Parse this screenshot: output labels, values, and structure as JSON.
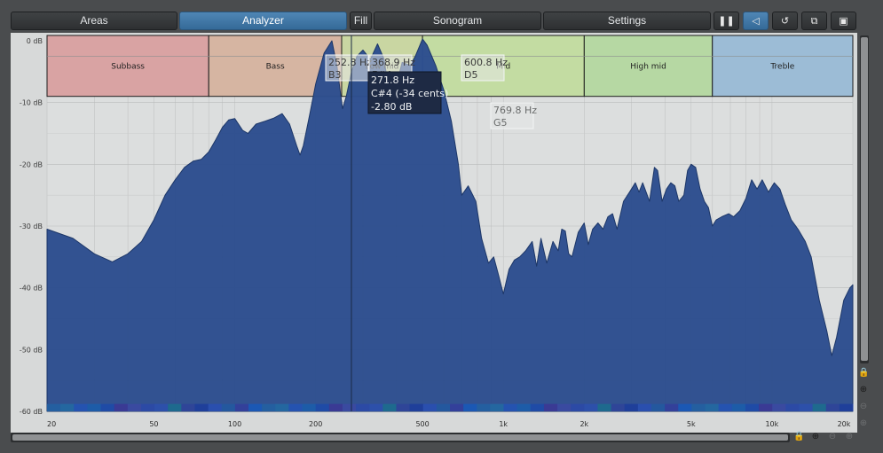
{
  "toolbar": {
    "tabs": [
      {
        "label": "Areas",
        "active": false
      },
      {
        "label": "Analyzer",
        "active": true
      },
      {
        "label": "Fill",
        "active": false
      },
      {
        "label": "Sonogram",
        "active": false
      },
      {
        "label": "Settings",
        "active": false
      }
    ],
    "icon_buttons": [
      {
        "icon": "pause-icon",
        "glyph": "❚❚",
        "active": false
      },
      {
        "icon": "speaker-select-icon",
        "glyph": "◁",
        "active": true
      },
      {
        "icon": "reset-icon",
        "glyph": "↺",
        "active": false
      },
      {
        "icon": "copy-icon",
        "glyph": "⧉",
        "active": false
      },
      {
        "icon": "paste-icon",
        "glyph": "▣",
        "active": false
      }
    ]
  },
  "colors": {
    "spectrum_fill": "#2e4f8f",
    "spectrum_stroke": "#1d3768",
    "plot_bg": "#d7d9d9",
    "grid": "#c2c4c4",
    "accent": "#3f78aa"
  },
  "y_axis": {
    "labels": [
      "0 dB",
      "-10 dB",
      "-20 dB",
      "-30 dB",
      "-40 dB",
      "-50 dB",
      "-60 dB"
    ],
    "values": [
      0,
      -10,
      -20,
      -30,
      -40,
      -50,
      -60
    ],
    "range": [
      -60,
      0
    ]
  },
  "x_axis": {
    "labels": [
      "20",
      "50",
      "100",
      "200",
      "500",
      "1k",
      "2k",
      "5k",
      "10k",
      "20k"
    ],
    "values": [
      20,
      50,
      100,
      200,
      500,
      1000,
      2000,
      5000,
      10000,
      20000
    ],
    "scale": "log",
    "range": [
      20,
      20000
    ]
  },
  "bands": [
    {
      "label": "Subbass",
      "from": 20,
      "to": 80,
      "color": "#d9a3a3"
    },
    {
      "label": "Bass",
      "from": 80,
      "to": 250,
      "color": "#d6b5a2"
    },
    {
      "label": "Low mid",
      "from": 250,
      "to": 500,
      "color": "#c9d6a2"
    },
    {
      "label": "Mid",
      "from": 500,
      "to": 2000,
      "color": "#c3dca2"
    },
    {
      "label": "High mid",
      "from": 2000,
      "to": 6000,
      "color": "#b6d8a3"
    },
    {
      "label": "Treble",
      "from": 6000,
      "to": 20000,
      "color": "#9cbcd6"
    }
  ],
  "spectrum": {
    "points": [
      [
        20,
        -30.5
      ],
      [
        25,
        -32
      ],
      [
        30,
        -34.5
      ],
      [
        35,
        -35.8
      ],
      [
        40,
        -34.5
      ],
      [
        45,
        -32.5
      ],
      [
        50,
        -29
      ],
      [
        55,
        -25
      ],
      [
        60,
        -22.5
      ],
      [
        65,
        -20.5
      ],
      [
        70,
        -19.5
      ],
      [
        75,
        -19.2
      ],
      [
        80,
        -18
      ],
      [
        85,
        -16
      ],
      [
        90,
        -14
      ],
      [
        95,
        -12.8
      ],
      [
        100,
        -12.6
      ],
      [
        107,
        -14.5
      ],
      [
        112,
        -15
      ],
      [
        120,
        -13.5
      ],
      [
        130,
        -13
      ],
      [
        140,
        -12.5
      ],
      [
        150,
        -11.8
      ],
      [
        160,
        -13.5
      ],
      [
        170,
        -17
      ],
      [
        175,
        -18.5
      ],
      [
        180,
        -17
      ],
      [
        190,
        -12
      ],
      [
        200,
        -7
      ],
      [
        215,
        -2
      ],
      [
        230,
        0
      ],
      [
        240,
        -4
      ],
      [
        252,
        -11
      ],
      [
        260,
        -9
      ],
      [
        272,
        -5
      ],
      [
        285,
        -2.5
      ],
      [
        300,
        -1.5
      ],
      [
        320,
        -3
      ],
      [
        340,
        -0.5
      ],
      [
        360,
        -3
      ],
      [
        380,
        -10
      ],
      [
        390,
        -11.5
      ],
      [
        400,
        -7
      ],
      [
        420,
        -3.5
      ],
      [
        450,
        -4
      ],
      [
        470,
        -2.5
      ],
      [
        500,
        0.3
      ],
      [
        520,
        -0.7
      ],
      [
        560,
        -4
      ],
      [
        600,
        -8
      ],
      [
        640,
        -13
      ],
      [
        680,
        -20
      ],
      [
        700,
        -25
      ],
      [
        740,
        -23.5
      ],
      [
        790,
        -26
      ],
      [
        830,
        -32
      ],
      [
        880,
        -36
      ],
      [
        920,
        -35
      ],
      [
        960,
        -38
      ],
      [
        1000,
        -41
      ],
      [
        1050,
        -37
      ],
      [
        1100,
        -35.5
      ],
      [
        1150,
        -35
      ],
      [
        1210,
        -34
      ],
      [
        1280,
        -32.5
      ],
      [
        1330,
        -36.5
      ],
      [
        1380,
        -32
      ],
      [
        1450,
        -36
      ],
      [
        1530,
        -32.5
      ],
      [
        1600,
        -34
      ],
      [
        1650,
        -30.5
      ],
      [
        1700,
        -30.8
      ],
      [
        1750,
        -34.5
      ],
      [
        1800,
        -35
      ],
      [
        1900,
        -31
      ],
      [
        2000,
        -29.5
      ],
      [
        2070,
        -33
      ],
      [
        2150,
        -30.5
      ],
      [
        2250,
        -29.5
      ],
      [
        2350,
        -30.5
      ],
      [
        2450,
        -28.5
      ],
      [
        2550,
        -28
      ],
      [
        2650,
        -30.5
      ],
      [
        2800,
        -26
      ],
      [
        2950,
        -24.5
      ],
      [
        3100,
        -23
      ],
      [
        3200,
        -24.5
      ],
      [
        3300,
        -23
      ],
      [
        3500,
        -26
      ],
      [
        3650,
        -20.5
      ],
      [
        3750,
        -21
      ],
      [
        3900,
        -26
      ],
      [
        4050,
        -24
      ],
      [
        4200,
        -23
      ],
      [
        4350,
        -23.5
      ],
      [
        4500,
        -26
      ],
      [
        4700,
        -25
      ],
      [
        4850,
        -21
      ],
      [
        5000,
        -20
      ],
      [
        5200,
        -20.5
      ],
      [
        5400,
        -24
      ],
      [
        5600,
        -26
      ],
      [
        5800,
        -27
      ],
      [
        6000,
        -30
      ],
      [
        6200,
        -29
      ],
      [
        6500,
        -28.5
      ],
      [
        6900,
        -28
      ],
      [
        7200,
        -28.5
      ],
      [
        7600,
        -27.5
      ],
      [
        8000,
        -25.5
      ],
      [
        8400,
        -22.5
      ],
      [
        8800,
        -24
      ],
      [
        9200,
        -22.5
      ],
      [
        9700,
        -24.5
      ],
      [
        10200,
        -23
      ],
      [
        10700,
        -24
      ],
      [
        11200,
        -26.5
      ],
      [
        11800,
        -29
      ],
      [
        12500,
        -30.5
      ],
      [
        13300,
        -32.5
      ],
      [
        14000,
        -35
      ],
      [
        15000,
        -42
      ],
      [
        16000,
        -47
      ],
      [
        16700,
        -51
      ],
      [
        17400,
        -48
      ],
      [
        18500,
        -42
      ],
      [
        19500,
        -40
      ],
      [
        20000,
        -39.5
      ]
    ]
  },
  "cursor": {
    "freq": 271.8,
    "db": -2.8
  },
  "peak_tooltips": [
    {
      "lines": [
        "252.8 Hz",
        "B3"
      ],
      "freq": 252.8,
      "db": -1.5
    },
    {
      "lines": [
        "368.9 Hz",
        "F#4"
      ],
      "freq": 368.9,
      "db": -1.5
    },
    {
      "lines": [
        "600.8 Hz",
        "D5"
      ],
      "freq": 600.8,
      "db": -1.5
    },
    {
      "lines": [
        "769.8 Hz",
        "G5"
      ],
      "freq": 769.8,
      "db": -10.5
    }
  ],
  "cursor_tooltip": {
    "lines": [
      "271.8 Hz",
      "C#4 (-34 cents)",
      "-2.80 dB"
    ]
  },
  "side_controls": [
    {
      "icon": "lock-icon",
      "glyph": "🔒",
      "dim": false
    },
    {
      "icon": "zoom-in-icon",
      "glyph": "⊕",
      "dim": false
    },
    {
      "icon": "zoom-out-icon",
      "glyph": "⊖",
      "dim": true
    },
    {
      "icon": "zoom-fit-icon",
      "glyph": "⊕",
      "dim": true
    }
  ],
  "bottom_controls": [
    {
      "icon": "lock-icon",
      "glyph": "🔒",
      "dim": false
    },
    {
      "icon": "zoom-in-icon",
      "glyph": "⊕",
      "dim": false
    },
    {
      "icon": "zoom-out-icon",
      "glyph": "⊖",
      "dim": true
    },
    {
      "icon": "zoom-fit-icon",
      "glyph": "⊕",
      "dim": true
    }
  ]
}
